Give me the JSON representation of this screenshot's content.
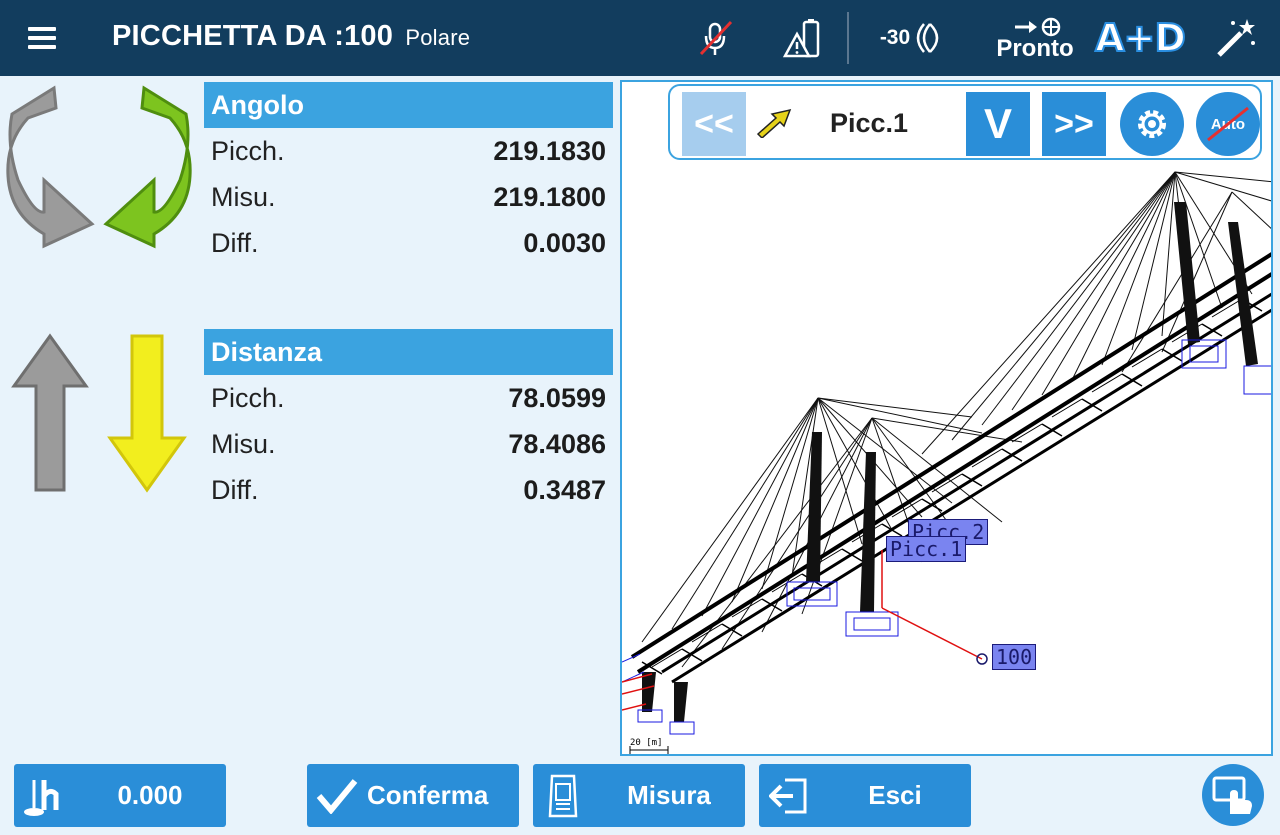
{
  "header": {
    "title": "PICCHETTA DA :100",
    "subtitle": "Polare",
    "prism_constant": "-30",
    "status": "Pronto",
    "mode": "A+D",
    "colors": {
      "bar": "#123d5e",
      "accent": "#3ba3e0"
    }
  },
  "angle": {
    "title": "Angolo",
    "rows": [
      {
        "label": "Picch.",
        "value": "219.1830"
      },
      {
        "label": "Misu.",
        "value": "219.1800"
      },
      {
        "label": "Diff.",
        "value": "0.0030"
      }
    ]
  },
  "distance": {
    "title": "Distanza",
    "rows": [
      {
        "label": "Picch.",
        "value": "78.0599"
      },
      {
        "label": "Misu.",
        "value": "78.4086"
      },
      {
        "label": "Diff.",
        "value": "0.3487"
      }
    ]
  },
  "map": {
    "prev_label": "<<",
    "next_label": ">>",
    "point_name": "Picc.1",
    "v_label": "V",
    "auto_label": "Auto",
    "tags": {
      "picc2": "Picc.2",
      "picc1": "Picc.1",
      "station": "100"
    },
    "scale": "20 [m]"
  },
  "footer": {
    "height_value": "0.000",
    "confirm_label": "Conferma",
    "measure_label": "Misura",
    "exit_label": "Esci"
  }
}
